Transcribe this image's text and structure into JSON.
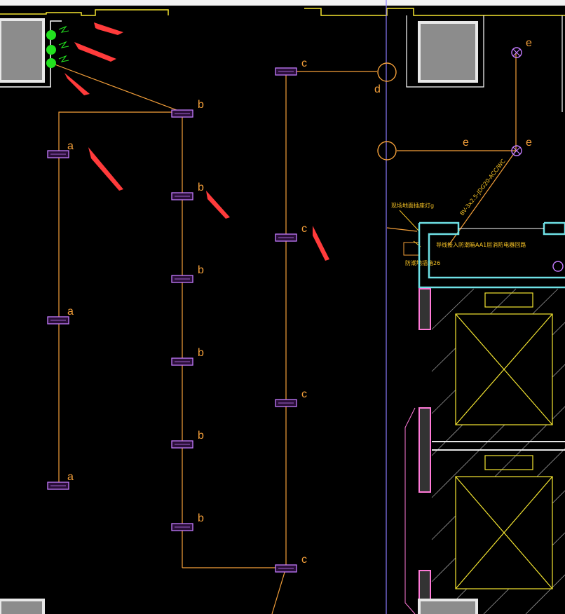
{
  "drawing": {
    "circuit_labels": {
      "a": "a",
      "b": "b",
      "c": "c",
      "d": "d",
      "e": "e"
    },
    "annotations": {
      "cable_spec": "BV-3x2.5-JDG20-ACC/WC",
      "note_1": "现场地面插座灯g",
      "note_2": "导线接入防潮箱AA1层消防电器回路",
      "note_3": "防潮地插箱26"
    },
    "colors": {
      "background": "#000000",
      "wire": "#f5a03a",
      "fixture": "#c47cff",
      "wall": "#f0f0f0",
      "wall_accent": "#6fe1e6",
      "highlight": "#f5e631",
      "arrow": "#ff3b3b",
      "junction": "#22e01f",
      "structure": "#ff7ad8",
      "axis": "#8c7cff"
    }
  }
}
